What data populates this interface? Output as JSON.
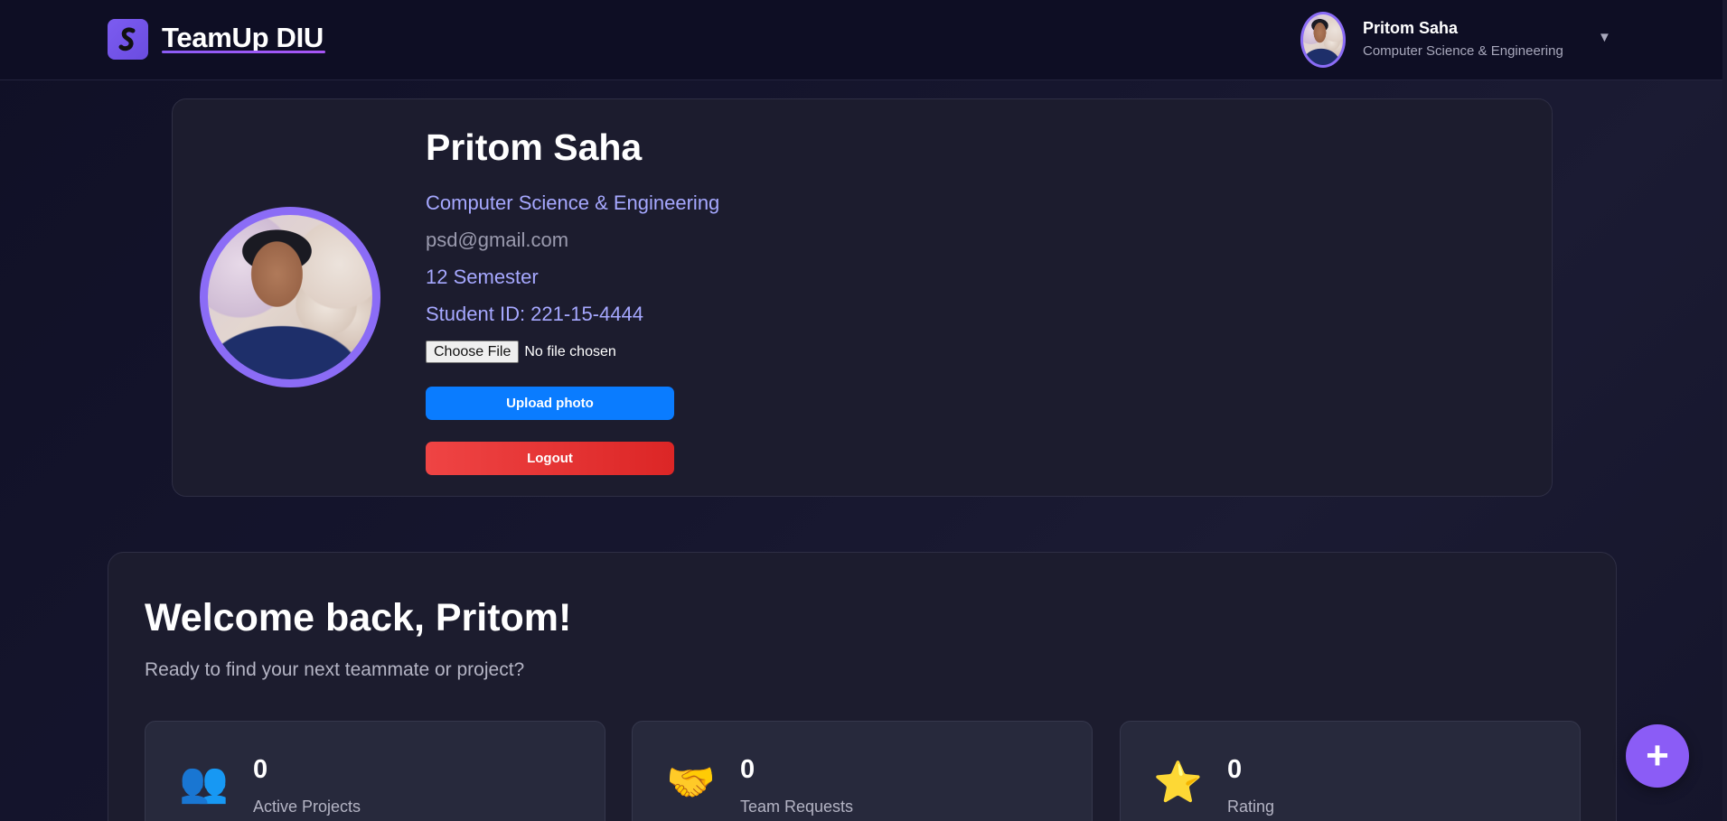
{
  "header": {
    "logo_text": "TeamUp DIU",
    "logo_icon": "s-logo-icon",
    "user_name": "Pritom Saha",
    "user_department": "Computer Science & Engineering",
    "dropdown_caret": "▼"
  },
  "profile": {
    "name": "Pritom Saha",
    "department": "Computer Science & Engineering",
    "email": "psd@gmail.com",
    "semester": "12 Semester",
    "student_id": "Student ID: 221-15-4444",
    "file_button_label": "Choose File",
    "file_status": "No file chosen",
    "upload_label": "Upload photo",
    "logout_label": "Logout"
  },
  "dashboard": {
    "welcome_title": "Welcome back, Pritom!",
    "welcome_subtitle": "Ready to find your next teammate or project?",
    "stats": [
      {
        "icon": "people-icon",
        "glyph": "👥",
        "value": "0",
        "label": "Active Projects"
      },
      {
        "icon": "handshake-icon",
        "glyph": "🤝",
        "value": "0",
        "label": "Team Requests"
      },
      {
        "icon": "star-icon",
        "glyph": "⭐",
        "value": "0",
        "label": "Rating"
      }
    ],
    "fab_symbol": "+"
  },
  "colors": {
    "accent": "#8b5cf6",
    "upload_button": "#0a7cff",
    "logout_button": "#ef4444",
    "info_text": "#a6a8ff"
  }
}
